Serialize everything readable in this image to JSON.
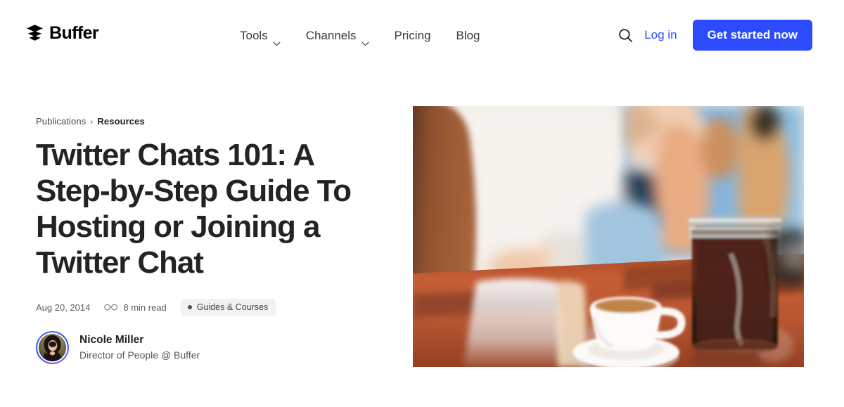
{
  "site": {
    "brand_name": "Buffer",
    "logo_icon": "stacked-layers-icon",
    "accent_color": "#2c4bff",
    "text_color": "#232323"
  },
  "header": {
    "nav": [
      {
        "label": "Tools",
        "has_dropdown": true,
        "icon": "chevron-down-icon"
      },
      {
        "label": "Channels",
        "has_dropdown": true,
        "icon": "chevron-down-icon"
      },
      {
        "label": "Pricing",
        "has_dropdown": false
      },
      {
        "label": "Blog",
        "has_dropdown": false
      }
    ],
    "search_icon": "search-icon",
    "login_label": "Log in",
    "cta_label": "Get started now"
  },
  "article": {
    "breadcrumb": {
      "parent": "Publications",
      "separator": "›",
      "current": "Resources"
    },
    "title": "Twitter Chats 101: A Step-by-Step Guide To Hosting or Joining a Twitter Chat",
    "meta": {
      "date": "Aug 20, 2014",
      "read_icon": "glasses-icon",
      "read_time": "8 min read",
      "tag": "Guides & Courses",
      "tag_dot_color": "#4d4d4d",
      "tag_background": "#f2f2f2"
    },
    "author": {
      "avatar_icon": "author-avatar",
      "name": "Nicole Miller",
      "role": "Director of People @ Buffer"
    },
    "hero_image": {
      "alt": "Blurred photo of two people at a glossy wooden cafe table with a white espresso cup on a saucer and a glass jar of cold brew coffee, blue wall in background",
      "dominant_colors": [
        "#b4592c",
        "#7fb4dd",
        "#f5f2ee",
        "#2a1408"
      ]
    }
  }
}
